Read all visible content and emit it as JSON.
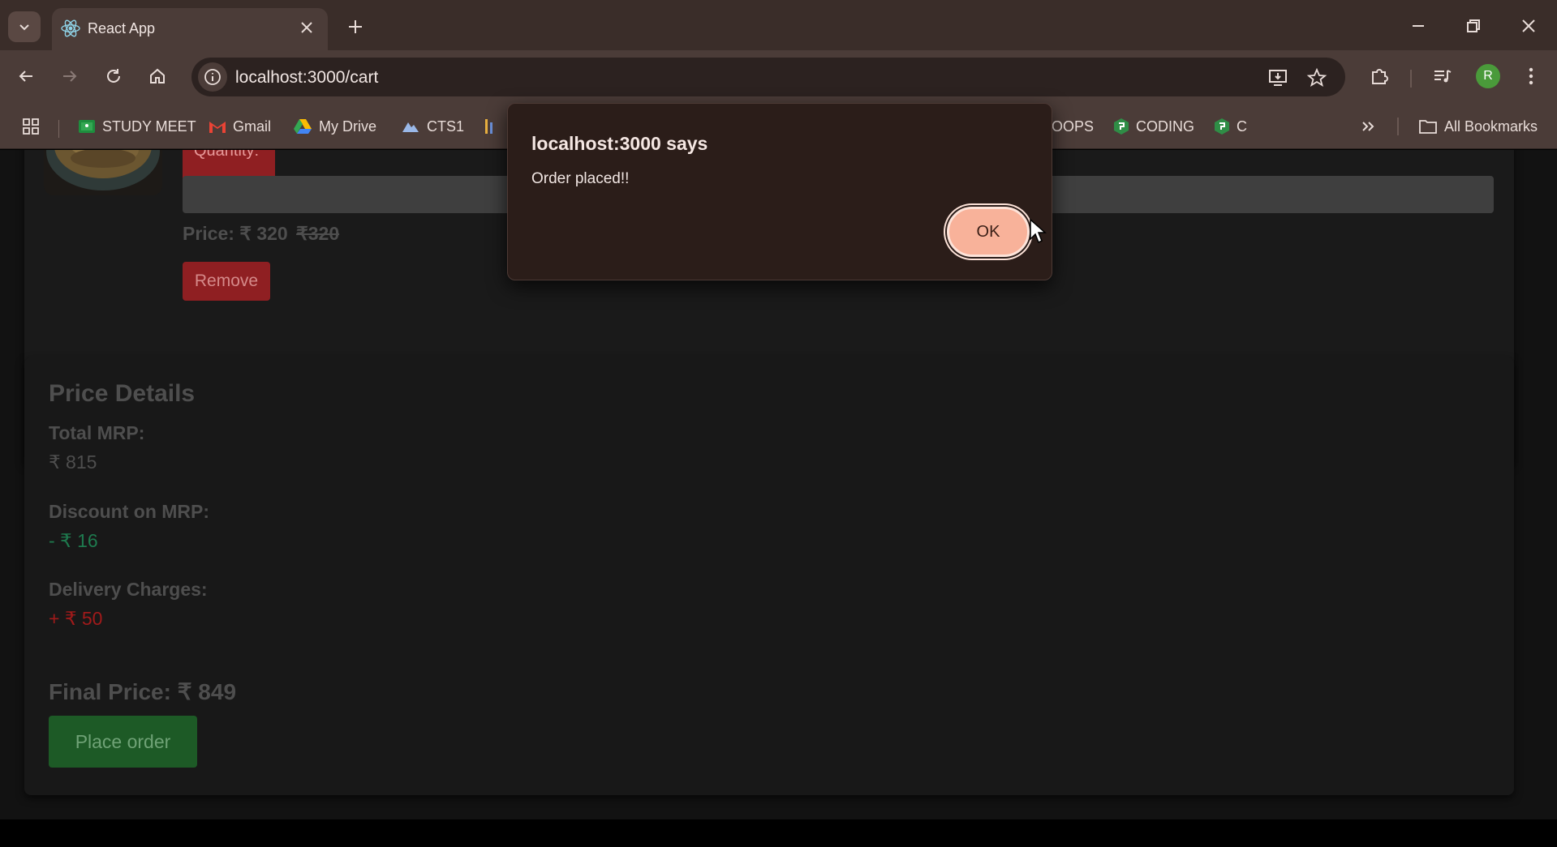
{
  "browser": {
    "tab_title": "React App",
    "url": "localhost:3000/cart",
    "avatar_initial": "R",
    "bookmarks": [
      {
        "label": "STUDY MEET",
        "icon": "classroom-icon"
      },
      {
        "label": "Gmail",
        "icon": "gmail-icon"
      },
      {
        "label": "My Drive",
        "icon": "drive-icon"
      },
      {
        "label": "CTS1",
        "icon": "cloud-icon"
      },
      {
        "label": "OOPS",
        "icon": "none"
      },
      {
        "label": "CODING",
        "icon": "gfg-icon"
      },
      {
        "label": "C",
        "icon": "gfg-icon"
      }
    ],
    "all_bookmarks": "All Bookmarks"
  },
  "cart_item": {
    "quantity_label": "Quantity:",
    "price_label": "Price: ₹ 320",
    "original_price": "₹320",
    "remove_label": "Remove"
  },
  "price_details": {
    "heading": "Price Details",
    "total_mrp_label": "Total MRP:",
    "total_mrp_value": "₹ 815",
    "discount_label": "Discount on MRP:",
    "discount_value": "- ₹ 16",
    "delivery_label": "Delivery Charges:",
    "delivery_value": "+ ₹ 50",
    "final_price": "Final Price: ₹ 849",
    "place_order_label": "Place order"
  },
  "dialog": {
    "title": "localhost:3000 says",
    "message": "Order placed!!",
    "ok_label": "OK"
  },
  "colors": {
    "discount": "#1e7a4e",
    "delivery": "#a01a1a",
    "ok_button": "#f8b29a"
  }
}
